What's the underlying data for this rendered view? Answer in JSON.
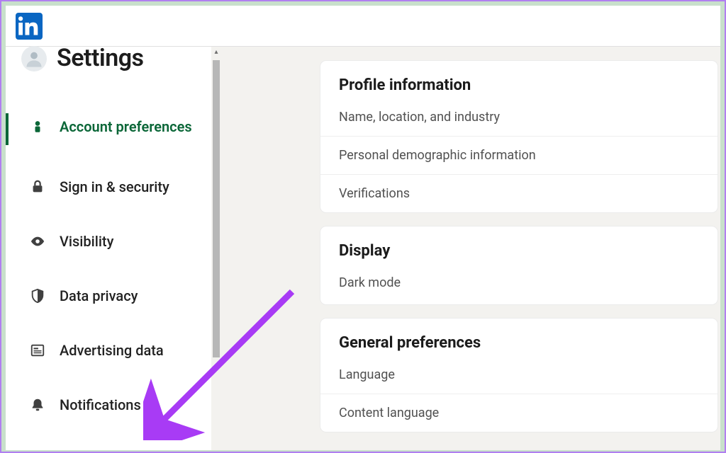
{
  "app": {
    "logo_letters": "in"
  },
  "sidebar": {
    "title": "Settings",
    "items": [
      {
        "label": "Account preferences",
        "icon": "person-icon",
        "active": true
      },
      {
        "label": "Sign in & security",
        "icon": "lock-icon",
        "active": false
      },
      {
        "label": "Visibility",
        "icon": "eye-icon",
        "active": false
      },
      {
        "label": "Data privacy",
        "icon": "shield-icon",
        "active": false
      },
      {
        "label": "Advertising data",
        "icon": "newspaper-icon",
        "active": false
      },
      {
        "label": "Notifications",
        "icon": "bell-icon",
        "active": false
      }
    ]
  },
  "content": {
    "sections": [
      {
        "title": "Profile information",
        "rows": [
          "Name, location, and industry",
          "Personal demographic information",
          "Verifications"
        ]
      },
      {
        "title": "Display",
        "rows": [
          "Dark mode"
        ]
      },
      {
        "title": "General preferences",
        "rows": [
          "Language",
          "Content language"
        ]
      }
    ]
  },
  "annotation": {
    "arrow_color": "#a83bf5",
    "points_to": "Notifications"
  }
}
